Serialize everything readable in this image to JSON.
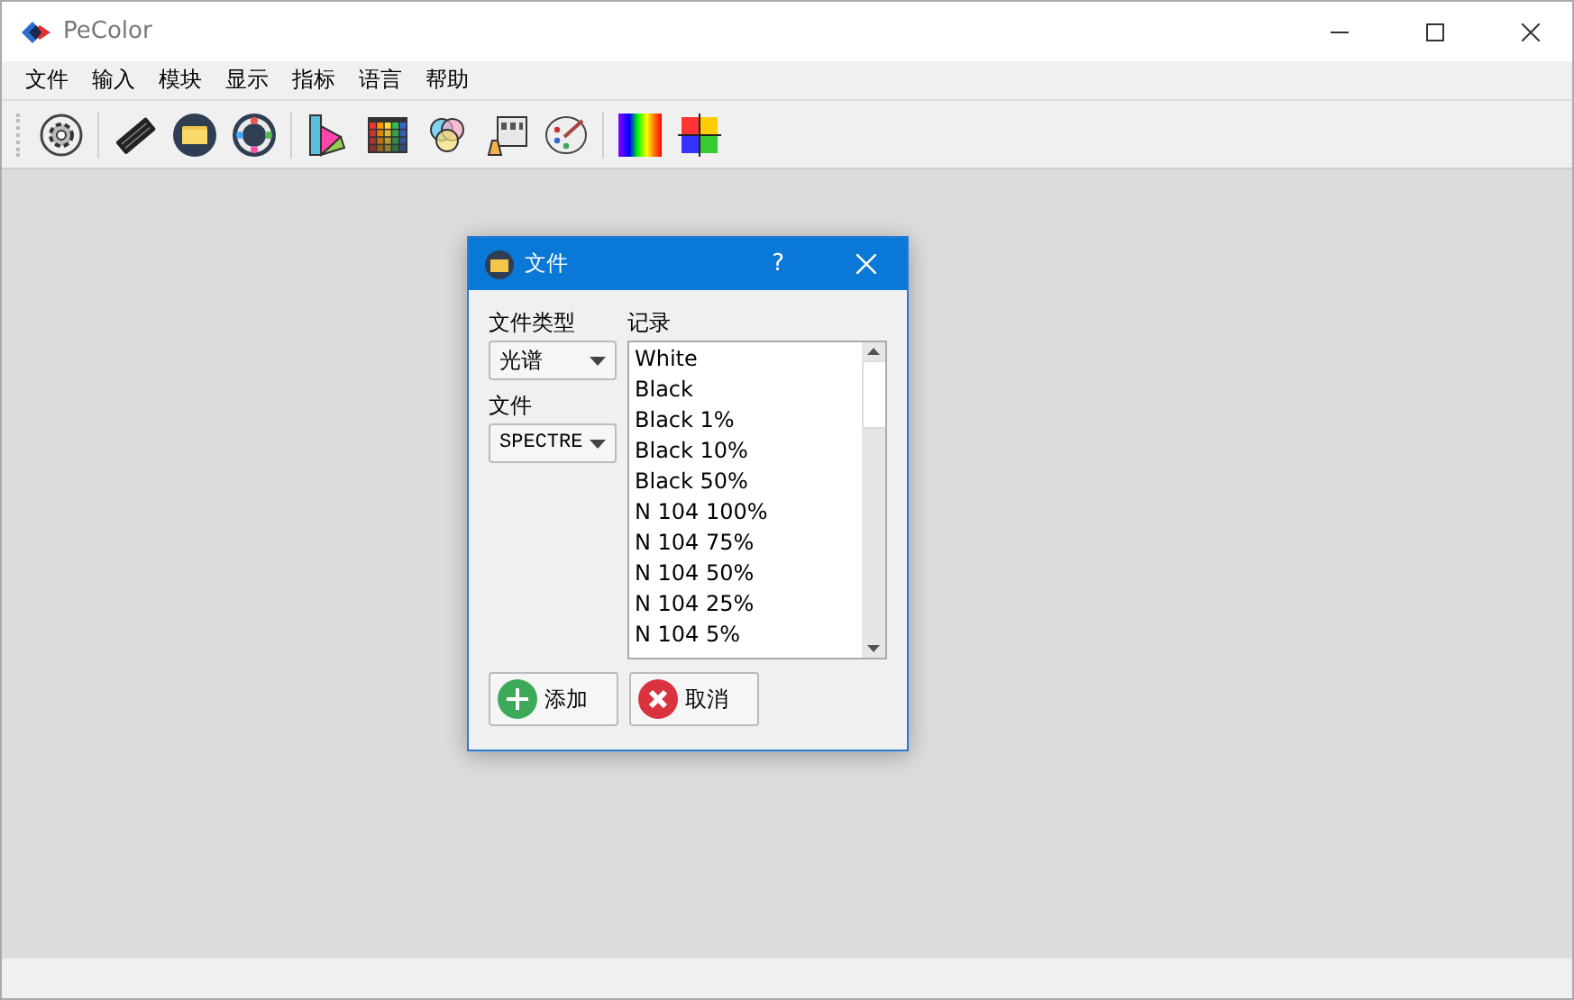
{
  "window": {
    "title": "PeColor"
  },
  "menu": [
    "文件",
    "输入",
    "模块",
    "显示",
    "指标",
    "语言",
    "帮助"
  ],
  "dialog": {
    "title": "文件",
    "help": "?",
    "file_type_label": "文件类型",
    "file_type": "光谱",
    "file_label": "文件",
    "file": "SPECTRE",
    "records_label": "记录",
    "records": [
      "White",
      "Black",
      "Black 1%",
      "Black 10%",
      "Black 50%",
      "N 104 100%",
      "N 104 75%",
      "N 104 50%",
      "N 104 25%",
      "N 104 5%"
    ],
    "buttons": [
      {
        "kind": "add",
        "label": "添加"
      },
      {
        "kind": "cancel",
        "label": "取消"
      }
    ]
  }
}
